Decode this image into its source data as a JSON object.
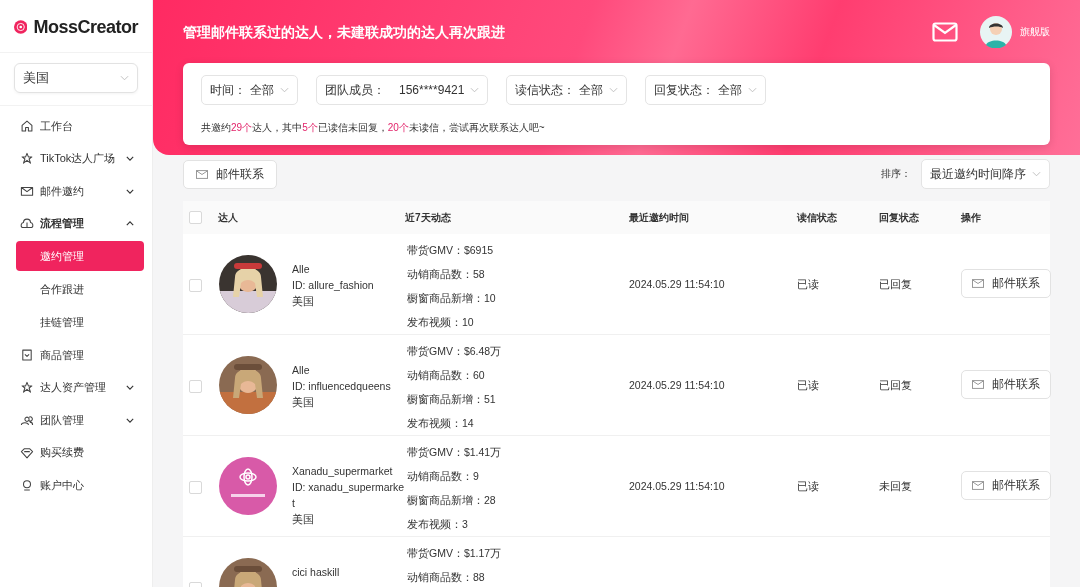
{
  "sidebar": {
    "logo": "MossCreator",
    "region": "美国",
    "items": [
      {
        "label": "工作台",
        "selected": false
      },
      {
        "label": "TikTok达人广场",
        "expanded": false,
        "selected": false
      },
      {
        "label": "邮件邀约",
        "expanded": false,
        "selected": false
      },
      {
        "label": "流程管理",
        "expanded": true,
        "selected": false,
        "children": [
          {
            "label": "邀约管理",
            "selected": true
          },
          {
            "label": "合作跟进",
            "selected": false
          },
          {
            "label": "挂链管理",
            "selected": false
          }
        ]
      },
      {
        "label": "商品管理",
        "selected": false
      },
      {
        "label": "达人资产管理",
        "expanded": false,
        "selected": false
      },
      {
        "label": "团队管理",
        "expanded": false,
        "selected": false
      },
      {
        "label": "购买续费",
        "selected": false
      },
      {
        "label": "账户中心",
        "selected": false
      }
    ]
  },
  "header": {
    "title": "管理邮件联系过的达人，未建联成功的达人再次跟进",
    "plan": "旗舰版"
  },
  "filters": [
    {
      "label": "时间：",
      "value": "全部"
    },
    {
      "label": "团队成员：",
      "value": "156****9421"
    },
    {
      "label": "读信状态：",
      "value": "全部"
    },
    {
      "label": "回复状态：",
      "value": "全部"
    }
  ],
  "summary": [
    {
      "text": "共邀约",
      "highlight": false
    },
    {
      "text": "29个",
      "highlight": true
    },
    {
      "text": "达人，其中",
      "highlight": false
    },
    {
      "text": "5个",
      "highlight": true
    },
    {
      "text": "已读信未回复，",
      "highlight": false
    },
    {
      "text": "20个",
      "highlight": true
    },
    {
      "text": "未读信，尝试再次联系达人吧~",
      "highlight": false
    }
  ],
  "toolbar": {
    "button": "邮件联系",
    "sort_label": "排序：",
    "sort_value": "最近邀约时间降序"
  },
  "table": {
    "columns": [
      "达人",
      "近7天动态",
      "最近邀约时间",
      "读信状态",
      "回复状态",
      "操作"
    ],
    "all_checked": false,
    "rows": [
      {
        "checked": false,
        "name": "Alle",
        "id": "ID: allure_fashion",
        "country": "美国",
        "stats": [
          "带货GMV：$6915",
          "动销商品数：58",
          "橱窗商品新增：10",
          "发布视频：10"
        ],
        "time": "2024.05.29 11:54:10",
        "read": "已读",
        "reply": "已回复",
        "action": "邮件联系"
      },
      {
        "checked": false,
        "name": "Alle",
        "id": "ID: influencedqueens",
        "country": "美国",
        "stats": [
          "带货GMV：$6.48万",
          "动销商品数：60",
          "橱窗商品新增：51",
          "发布视频：14"
        ],
        "time": "2024.05.29 11:54:10",
        "read": "已读",
        "reply": "已回复",
        "action": "邮件联系"
      },
      {
        "checked": false,
        "name": "Xanadu_supermarket",
        "id": "ID: xanadu_supermarket",
        "country": "美国",
        "stats": [
          "带货GMV：$1.41万",
          "动销商品数：9",
          "橱窗商品新增：28",
          "发布视频：3"
        ],
        "time": "2024.05.29 11:54:10",
        "read": "已读",
        "reply": "未回复",
        "action": "邮件联系"
      },
      {
        "checked": false,
        "name": "cici haskill",
        "stats": [
          "带货GMV：$1.17万",
          "动销商品数：88"
        ]
      }
    ]
  }
}
